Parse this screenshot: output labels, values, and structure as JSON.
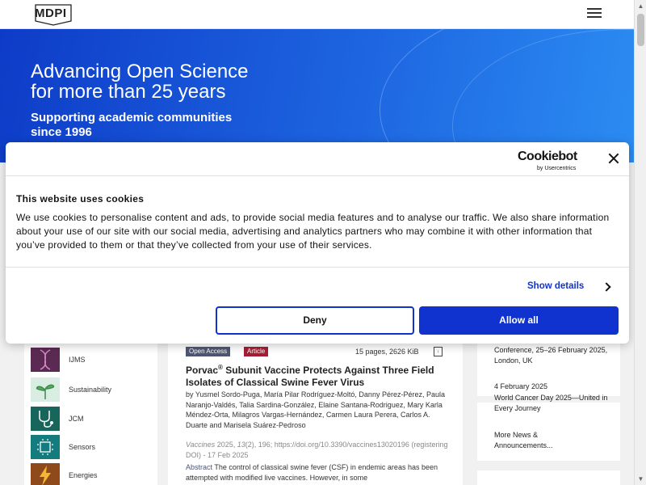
{
  "header": {
    "logo_text": "MDPI",
    "menu_icon": "hamburger-menu-icon"
  },
  "hero": {
    "title_line1": "Advancing Open Science",
    "title_line2": "for more than 25 years",
    "subtitle_line1": "Supporting academic communities",
    "subtitle_line2": "since 1996"
  },
  "journals": [
    {
      "name": "IJMS",
      "icon": "dna-icon",
      "color": "#5b2a52"
    },
    {
      "name": "Sustainability",
      "icon": "sprout-icon",
      "color": "#d9ede2"
    },
    {
      "name": "JCM",
      "icon": "stethoscope-icon",
      "color": "#17655b"
    },
    {
      "name": "Sensors",
      "icon": "chip-icon",
      "color": "#147b7f"
    },
    {
      "name": "Energies",
      "icon": "lightning-icon",
      "color": "#8e4a1b"
    }
  ],
  "article": {
    "badge_open_access": "Open Access",
    "badge_type": "Article",
    "pages_info": "15 pages, 2626 KiB",
    "pdf_icon": "pdf-download-icon",
    "title_prefix": "Porvac",
    "title_sup": "®",
    "title_rest": " Subunit Vaccine Protects Against Three Field Isolates of Classical Swine Fever Virus",
    "authors": "by Yusmel Sordo-Puga, María Pilar Rodríguez-Moltó, Danny Pérez-Pérez, Paula Naranjo-Valdés, Talia Sardina-González, Elaine Santana-Rodriguez, Mary Karla Méndez-Orta, Milagros Vargas-Hernández, Carmen Laura Perera, Carlos A. Duarte and Marisela Suárez-Pedroso",
    "journal": "Vaccines",
    "year": "2025",
    "volume": "13",
    "issue_page": "(2), 196; https://doi.org/10.3390/vaccines13020196",
    "registering": "(registering DOI) - 17 Feb 2025",
    "abstract_label": "Abstract",
    "abstract_text": " The control of classical swine fever (CSF) in endemic areas has been attempted with modified live vaccines. However, in some"
  },
  "news": {
    "item1": "Conference, 25–26 February 2025, London, UK",
    "item2_date": "4 February 2025",
    "item2_text": "World Cancer Day 2025—United in Every Journey",
    "more": "More News & Announcements..."
  },
  "cookie": {
    "brand": "Cookiebot",
    "by": "by Usercentrics",
    "close_icon": "close-icon",
    "heading": "This website uses cookies",
    "body": "We use cookies to personalise content and ads, to provide social media features and to analyse our traffic. We also share information about your use of our site with our social media, advertising and analytics partners who may combine it with other information that you’ve provided to them or that they’ve collected from your use of their services.",
    "show_details": "Show details",
    "deny": "Deny",
    "allow_all": "Allow all",
    "accent_color": "#1032cf"
  }
}
